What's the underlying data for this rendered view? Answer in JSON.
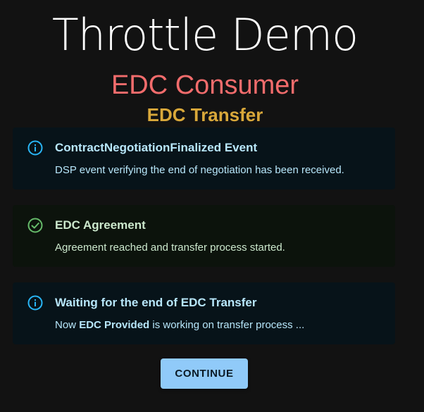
{
  "header": {
    "title": "Throttle Demo",
    "subtitle": "EDC Consumer",
    "section": "EDC Transfer"
  },
  "alerts": [
    {
      "severity": "info",
      "icon": "info-icon",
      "title": "ContractNegotiationFinalized Event",
      "text": "DSP event verifying the end of negotiation has been received."
    },
    {
      "severity": "success",
      "icon": "check-circle-icon",
      "title": "EDC Agreement",
      "text": "Agreement reached and transfer process started."
    },
    {
      "severity": "info",
      "icon": "info-icon",
      "title": "Waiting for the end of EDC Transfer",
      "text_prefix": "Now ",
      "text_bold": "EDC Provided",
      "text_suffix": " is working on transfer process ..."
    }
  ],
  "actions": {
    "continue_label": "CONTINUE"
  },
  "colors": {
    "background": "#121212",
    "subtitle": "#f26c6c",
    "section": "#d9a83a",
    "info_icon": "#29b6f6",
    "success_icon": "#66bb6a",
    "button": "#90caf9"
  }
}
